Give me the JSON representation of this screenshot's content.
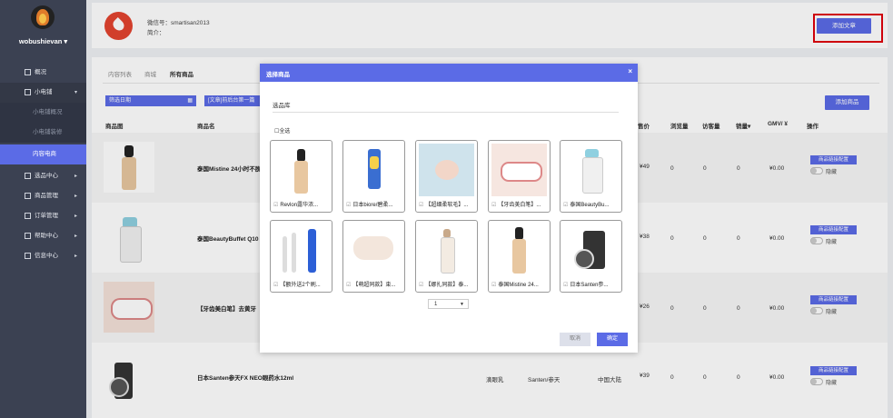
{
  "sidebar": {
    "username": "wobushievan ▾",
    "items": [
      {
        "label": "概况"
      },
      {
        "label": "小电铺",
        "arrow": "▾"
      },
      {
        "label": "小电铺概况"
      },
      {
        "label": "小电铺装修"
      },
      {
        "label": "内容电商"
      },
      {
        "label": "选品中心",
        "arrow": "▸"
      },
      {
        "label": "商品管理",
        "arrow": "▸"
      },
      {
        "label": "订单管理",
        "arrow": "▸"
      },
      {
        "label": "帮助中心",
        "arrow": "▸"
      },
      {
        "label": "信息中心",
        "arrow": "▸"
      }
    ]
  },
  "profile": {
    "wechat": "微信号：smartisan2013",
    "intro": "简介："
  },
  "header": {
    "add_article": "添加文章"
  },
  "tabs": [
    "内容列表",
    "商城",
    "所有商品"
  ],
  "filters": {
    "date": "筛选日期",
    "article": "[文章]前后台第一篇"
  },
  "add_product": "添加商品",
  "columns": {
    "img": "商品图",
    "name": "商品名",
    "price": "售价",
    "views": "浏览量",
    "visitors": "访客量",
    "sales": "销量▾",
    "gmv": "GMV/ ¥",
    "ops": "操作"
  },
  "rows": [
    {
      "name": "泰国Mistine 24小时不脱",
      "price": "¥49",
      "views": "0",
      "visitors": "0",
      "sales": "0",
      "gmv": "¥0.00"
    },
    {
      "name": "泰国BeautyBuffet Q10",
      "price": "¥38",
      "views": "0",
      "visitors": "0",
      "sales": "0",
      "gmv": "¥0.00"
    },
    {
      "name": "【牙齿美白笔】去黄牙",
      "price": "¥26",
      "views": "0",
      "visitors": "0",
      "sales": "0",
      "gmv": "¥0.00"
    },
    {
      "name": "日本Santen参天FX NEO眼药水12ml",
      "type": "滴眼乳",
      "brand": "Santen/参天",
      "origin": "中国大陆",
      "price": "¥39",
      "views": "0",
      "visitors": "0",
      "sales": "0",
      "gmv": "¥0.00"
    }
  ],
  "row_ops": {
    "config": "商品链接配置",
    "hide": "隐藏"
  },
  "modal": {
    "title": "选择商品",
    "close": "×",
    "library": "选品库",
    "select_all": "全选",
    "products": [
      "Revlon露华浓...",
      "日本biore/碧柔...",
      "【超细柔软毛】...",
      "【牙齿美白笔】...",
      "泰国BeautyBu...",
      "【额外送2个刷...",
      "【萌超同款】束...",
      "【娜扎同款】泰...",
      "泰国Mistine 24...",
      "日本Santen参..."
    ],
    "page": "1",
    "cancel": "取消",
    "confirm": "确定"
  }
}
